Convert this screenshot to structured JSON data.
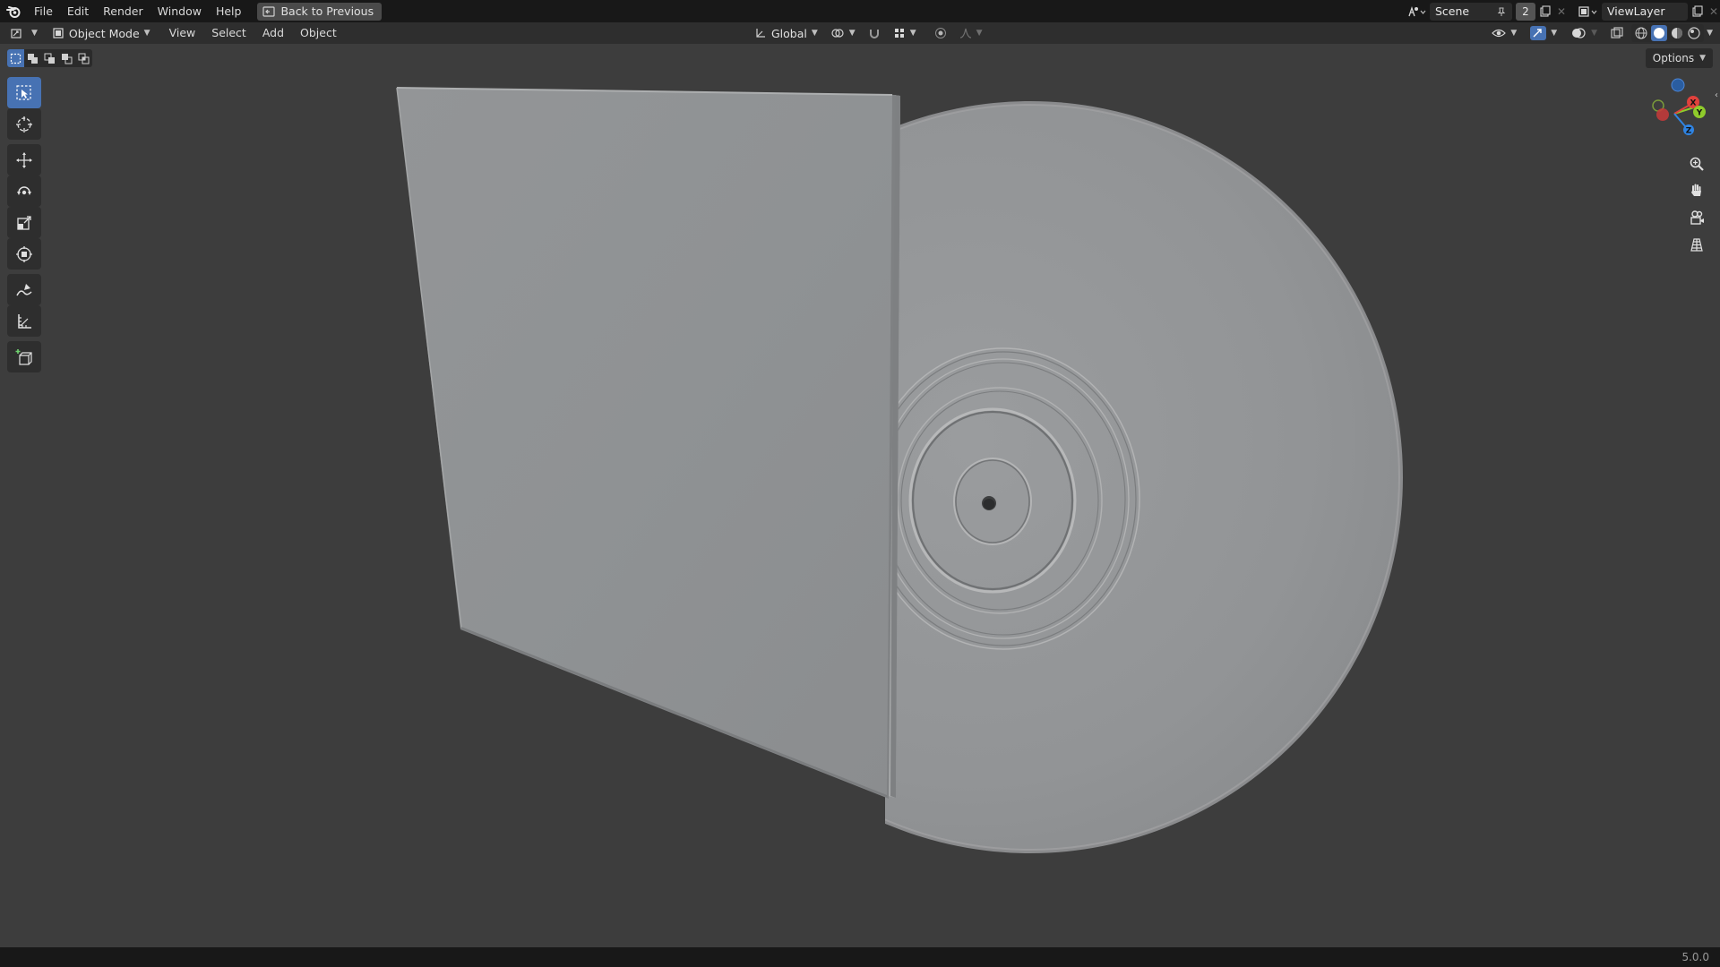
{
  "app": {
    "menu": [
      "File",
      "Edit",
      "Render",
      "Window",
      "Help"
    ],
    "back_button": "Back to Previous",
    "scene_name": "Scene",
    "scene_users": "2",
    "view_layer": "ViewLayer",
    "version": "5.0.0"
  },
  "header": {
    "mode": "Object Mode",
    "menus": [
      "View",
      "Select",
      "Add",
      "Object"
    ],
    "orientation": "Global"
  },
  "viewport": {
    "options_label": "Options",
    "gizmo_axes": [
      "X",
      "Y",
      "Z"
    ]
  },
  "icons": {
    "logo": "blender-logo-icon",
    "editor_type": "3d-viewport-icon",
    "tools": [
      "select-box-icon",
      "cursor-icon",
      "move-icon",
      "rotate-icon",
      "scale-icon",
      "transform-icon",
      "annotate-icon",
      "measure-icon",
      "add-cube-icon"
    ],
    "nav": [
      "zoom-icon",
      "pan-hand-icon",
      "camera-icon",
      "ortho-grid-icon"
    ]
  },
  "colors": {
    "accent": "#4772b3",
    "axis_x": "#e0413c",
    "axis_y": "#8fcb2b",
    "axis_z": "#2f84e3"
  }
}
